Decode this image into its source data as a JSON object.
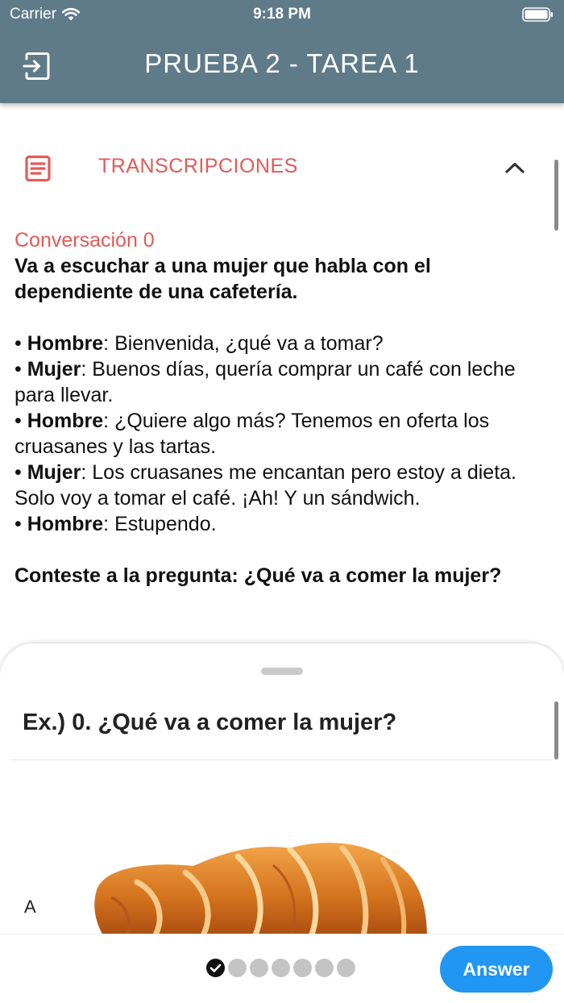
{
  "status_bar": {
    "carrier": "Carrier",
    "time": "9:18 PM"
  },
  "header": {
    "title": "PRUEBA 2 - TAREA 1",
    "exit_icon": "exit-icon",
    "background_color": "#5f7b8a"
  },
  "transcripts": {
    "section_title": "TRANSCRIPCIONES",
    "section_icon": "document-icon",
    "toggle_icon": "chevron-up-icon",
    "accent_color": "#e45a57",
    "conversation_title": "Conversación 0",
    "intro": "Va a escuchar a una mujer que habla con el dependiente de una cafetería.",
    "lines": [
      {
        "speaker": "Hombre",
        "text": ": Bienvenida, ¿qué va a tomar?"
      },
      {
        "speaker": "Mujer",
        "text": ": Buenos días, quería comprar un café con leche para llevar."
      },
      {
        "speaker": "Hombre",
        "text": ": ¿Quiere algo más? Tenemos en oferta los cruasanes y las tartas."
      },
      {
        "speaker": "Mujer",
        "text": ": Los cruasanes me encantan pero estoy a dieta. Solo voy a tomar el café. ¡Ah! Y un sándwich."
      },
      {
        "speaker": "Hombre",
        "text": ": Estupendo."
      }
    ],
    "bullet": "• ",
    "question_prompt": "Conteste a la pregunta: ¿Qué va a comer la mujer?"
  },
  "sheet": {
    "question": "Ex.) 0. ¿Qué va a comer la mujer?",
    "options": [
      {
        "label": "A",
        "image": "croissant"
      }
    ]
  },
  "footer": {
    "progress": {
      "total": 7,
      "completed": 1
    },
    "answer_label": "Answer",
    "answer_color": "#2196f3"
  }
}
